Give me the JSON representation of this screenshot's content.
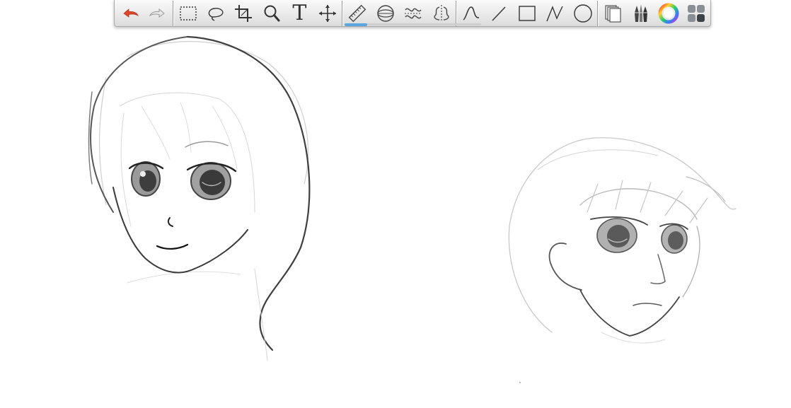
{
  "toolbar": {
    "text_tool_label": "T",
    "groups": {
      "history": [
        "undo-icon",
        "redo-icon"
      ],
      "selection": [
        "rectangle-select-icon",
        "lasso-select-icon",
        "crop-icon",
        "zoom-icon",
        "text-icon",
        "move-icon"
      ],
      "guides": [
        "ruler-icon",
        "ellipse-guide-icon",
        "perspective-guide-icon",
        "symmetry-icon"
      ],
      "shapes": [
        "freehand-stroke-icon",
        "straight-line-icon",
        "rectangle-shape-icon",
        "polyline-icon",
        "circle-shape-icon"
      ],
      "panels": [
        "layers-icon",
        "brushes-icon",
        "color-wheel-icon",
        "brush-presets-icon"
      ]
    },
    "active_shape_tool": "freehand-stroke-icon",
    "colors": {
      "undo": "#e0452a",
      "active_indicator": "#5aa7e0"
    }
  },
  "canvas": {
    "content": "sketch-drawing"
  }
}
